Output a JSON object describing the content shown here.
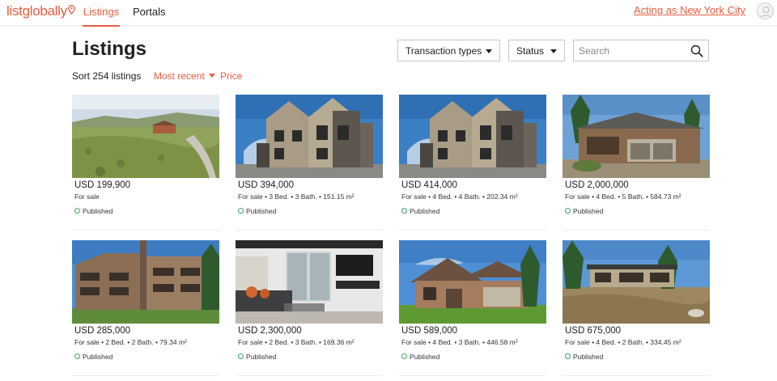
{
  "header": {
    "logo_text": "listglobally",
    "tabs": [
      {
        "label": "Listings",
        "active": true
      },
      {
        "label": "Portals",
        "active": false
      }
    ],
    "acting_as": "Acting as New York City"
  },
  "page": {
    "title": "Listings",
    "filters": {
      "transaction_types": "Transaction types",
      "status": "Status",
      "search_placeholder": "Search"
    },
    "sort": {
      "count_text": "Sort 254 listings",
      "most_recent": "Most recent",
      "price": "Price"
    }
  },
  "colors": {
    "accent": "#e85d3f",
    "published": "#3aa35a"
  },
  "listings": [
    {
      "price": "USD 199,900",
      "meta": "For sale",
      "status": "Published",
      "image": "land-lot-with-house"
    },
    {
      "price": "USD 394,000",
      "meta": "For sale • 3 Bed. • 3 Bath. • 151.15 m²",
      "status": "Published",
      "image": "stone-townhouse"
    },
    {
      "price": "USD 414,000",
      "meta": "For sale • 4 Bed. • 4 Bath. • 202.34 m²",
      "status": "Published",
      "image": "stone-townhouse"
    },
    {
      "price": "USD 2,000,000",
      "meta": "For sale • 4 Bed. • 5 Bath. • 584.73 m²",
      "status": "Published",
      "image": "mountain-home-garage"
    },
    {
      "price": "USD 285,000",
      "meta": "For sale • 2 Bed. • 2 Bath. • 79.34 m²",
      "status": "Published",
      "image": "apartment-building"
    },
    {
      "price": "USD 2,300,000",
      "meta": "For sale • 2 Bed. • 3 Bath. • 169.36 m²",
      "status": "Published",
      "image": "modern-living-room"
    },
    {
      "price": "USD 589,000",
      "meta": "For sale • 4 Bed. • 3 Bath. • 446.58 m²",
      "status": "Published",
      "image": "brick-suburban-house"
    },
    {
      "price": "USD 675,000",
      "meta": "For sale • 4 Bed. • 2 Bath. • 334.45 m²",
      "status": "Published",
      "image": "flat-roof-house"
    }
  ]
}
